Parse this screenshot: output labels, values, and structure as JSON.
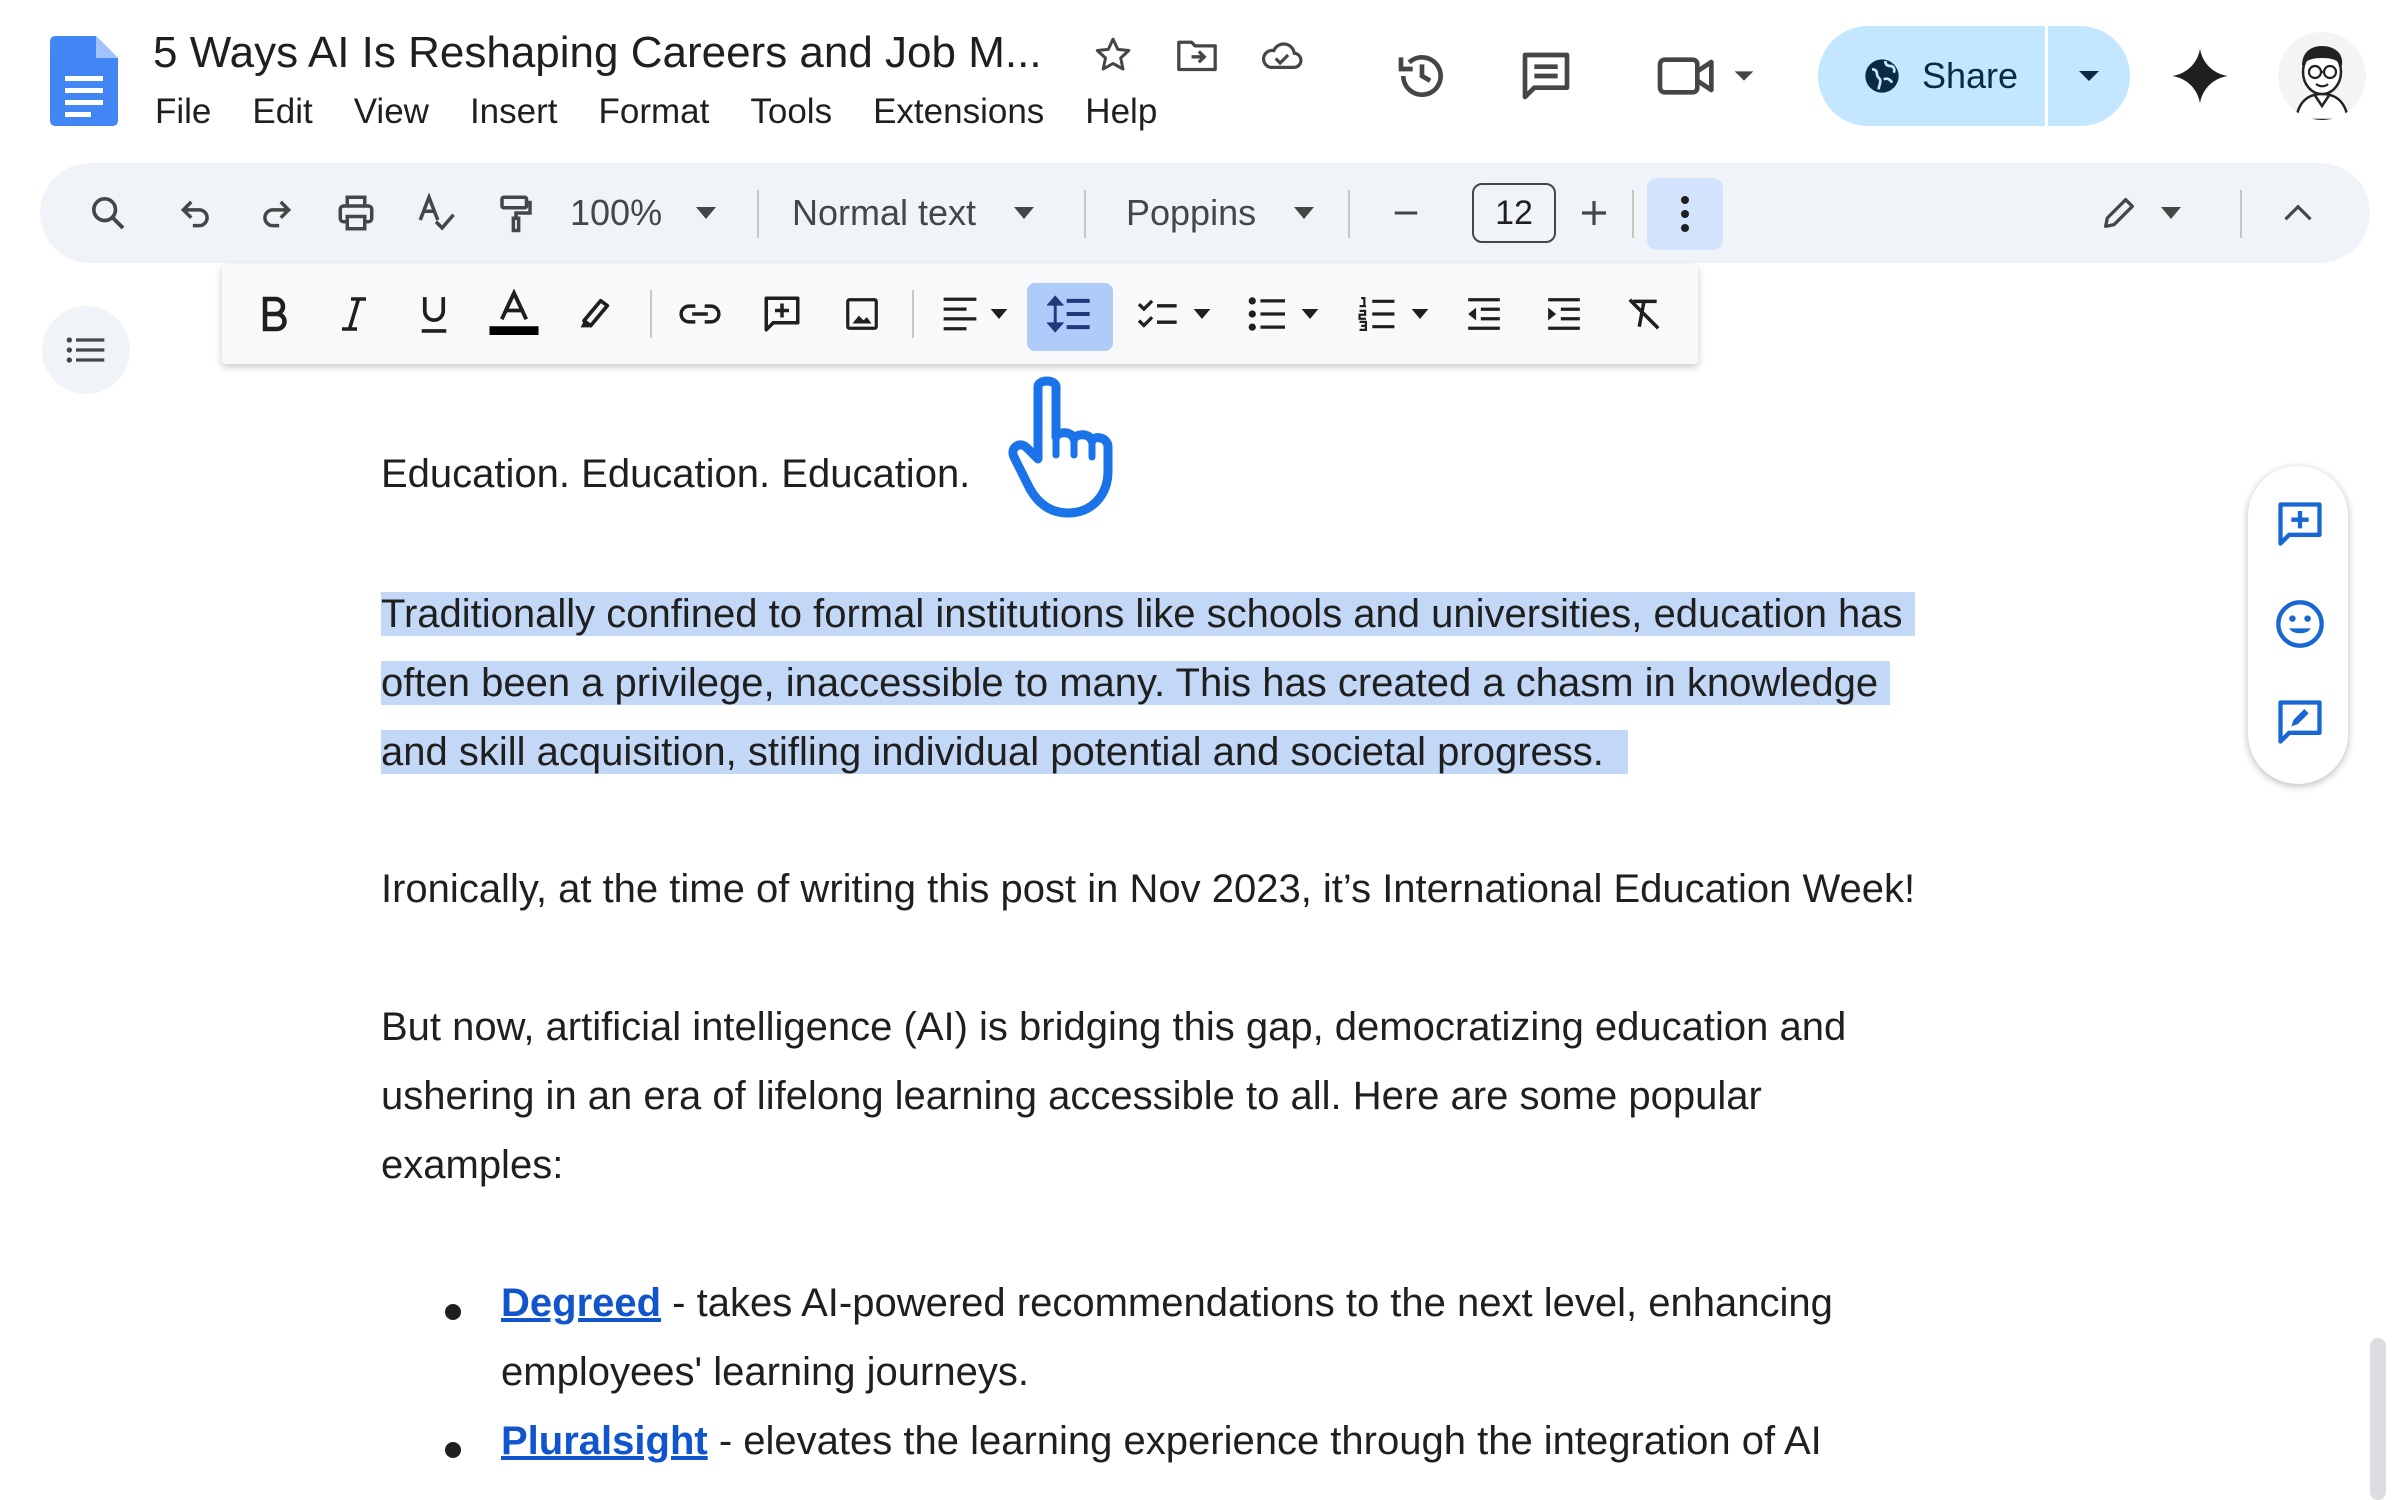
{
  "document": {
    "title": "5 Ways AI Is Reshaping Careers and Job M..."
  },
  "menu": [
    "File",
    "Edit",
    "View",
    "Insert",
    "Format",
    "Tools",
    "Extensions",
    "Help"
  ],
  "share": {
    "label": "Share"
  },
  "toolbar": {
    "zoom": "100%",
    "style": "Normal text",
    "font": "Poppins",
    "font_size": "12"
  },
  "body": {
    "p1": "Education. Education. Education.",
    "p2_lines": [
      "Traditionally confined to formal institutions like schools and universities, education has",
      "often been a privilege, inaccessible to many. This has created a chasm in knowledge",
      "and skill acquisition, stifling individual potential and societal progress."
    ],
    "p3": "Ironically, at the time of writing this post in Nov 2023, it’s International Education Week!",
    "p4_lines": [
      "But now, artificial intelligence (AI) is bridging this gap, democratizing education and",
      "ushering in an era of lifelong learning accessible to all. Here are some popular",
      "examples:"
    ],
    "list": [
      {
        "link": "Degreed",
        "text_line1": " - takes AI-powered recommendations to the next level, enhancing",
        "text_line2": "employees' learning journeys."
      },
      {
        "link": "Pluralsight",
        "text_line1": " - elevates the learning experience through the integration of AI"
      }
    ]
  },
  "colors": {
    "selection": "#c3d7f6",
    "link": "#1155cc",
    "share_bg": "#c2e7ff",
    "toolbar_bg": "#f0f4f9",
    "docs_blue": "#4285f4"
  }
}
